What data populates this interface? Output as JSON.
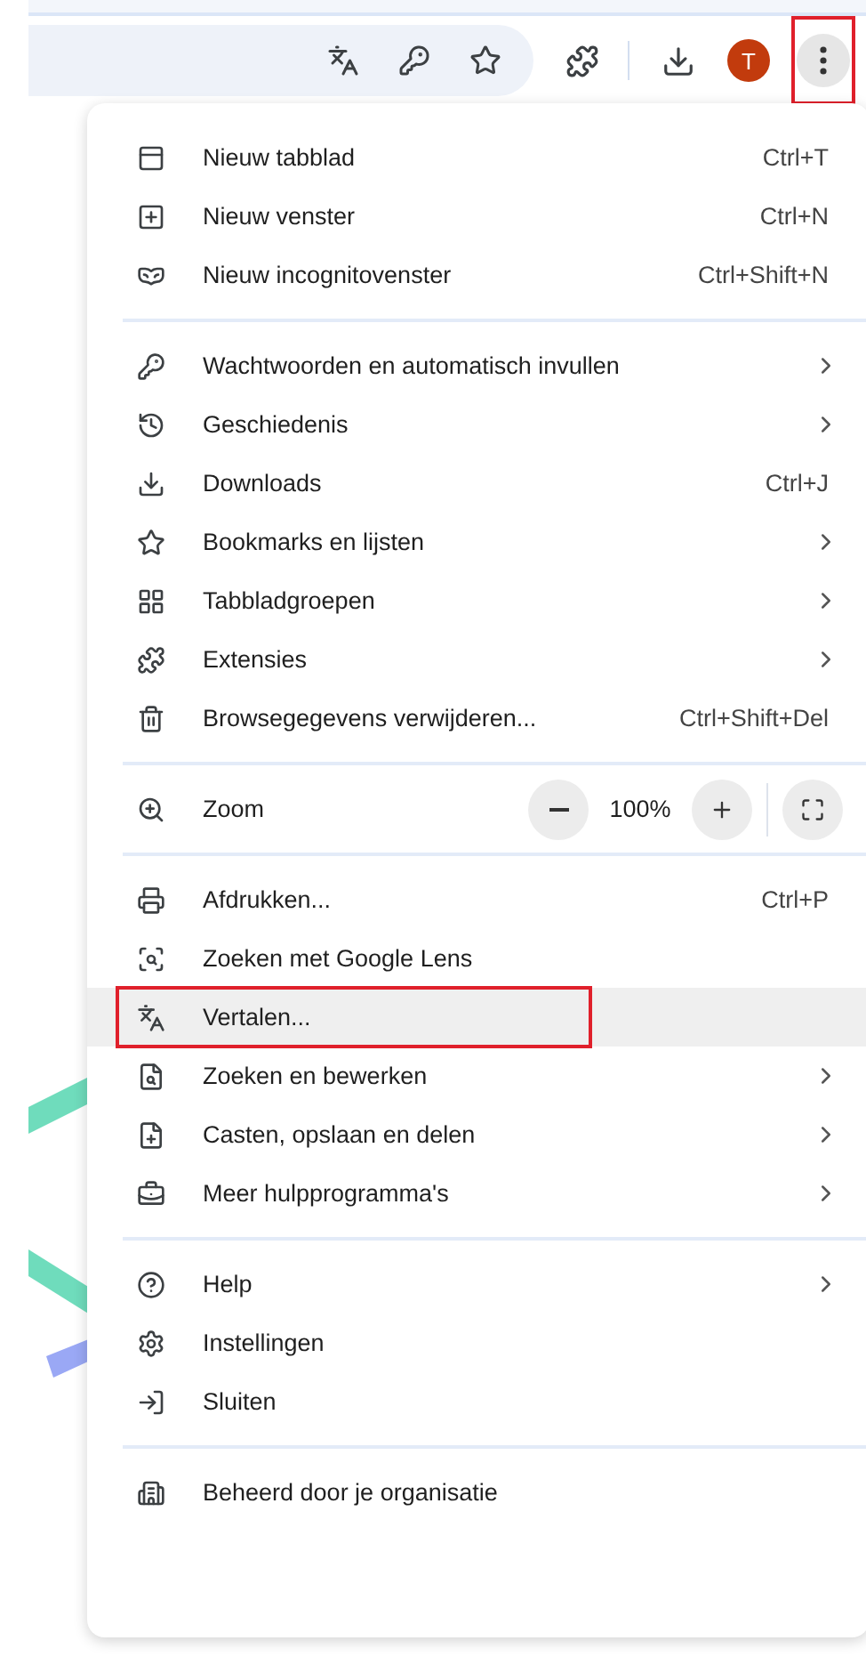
{
  "toolbar": {
    "avatar": "T",
    "menu_button": {
      "annotated": true
    }
  },
  "menu": {
    "sections": [
      {
        "kind": "items",
        "items": [
          {
            "label": "Nieuw tabblad",
            "shortcut": "Ctrl+T",
            "submenu": false,
            "highlighted": false,
            "annotated": false
          },
          {
            "label": "Nieuw venster",
            "shortcut": "Ctrl+N",
            "submenu": false,
            "highlighted": false,
            "annotated": false
          },
          {
            "label": "Nieuw incognitovenster",
            "shortcut": "Ctrl+Shift+N",
            "submenu": false,
            "highlighted": false,
            "annotated": false
          }
        ]
      },
      {
        "kind": "items",
        "items": [
          {
            "label": "Wachtwoorden en automatisch invullen",
            "submenu": true,
            "highlighted": false,
            "annotated": false
          },
          {
            "label": "Geschiedenis",
            "submenu": true,
            "highlighted": false,
            "annotated": false
          },
          {
            "label": "Downloads",
            "shortcut": "Ctrl+J",
            "submenu": false,
            "highlighted": false,
            "annotated": false
          },
          {
            "label": "Bookmarks en lijsten",
            "submenu": true,
            "highlighted": false,
            "annotated": false
          },
          {
            "label": "Tabbladgroepen",
            "submenu": true,
            "highlighted": false,
            "annotated": false
          },
          {
            "label": "Extensies",
            "submenu": true,
            "highlighted": false,
            "annotated": false
          },
          {
            "label": "Browsegegevens verwijderen...",
            "shortcut": "Ctrl+Shift+Del",
            "submenu": false,
            "highlighted": false,
            "annotated": false
          }
        ]
      },
      {
        "kind": "zoom",
        "label": "Zoom",
        "value": "100%"
      },
      {
        "kind": "items",
        "items": [
          {
            "label": "Afdrukken...",
            "shortcut": "Ctrl+P",
            "submenu": false,
            "highlighted": false,
            "annotated": false
          },
          {
            "label": "Zoeken met Google Lens",
            "submenu": false,
            "highlighted": false,
            "annotated": false
          },
          {
            "label": "Vertalen...",
            "submenu": false,
            "highlighted": true,
            "annotated": true
          },
          {
            "label": "Zoeken en bewerken",
            "submenu": true,
            "highlighted": false,
            "annotated": false
          },
          {
            "label": "Casten, opslaan en delen",
            "submenu": true,
            "highlighted": false,
            "annotated": false
          },
          {
            "label": "Meer hulpprogramma's",
            "submenu": true,
            "highlighted": false,
            "annotated": false
          }
        ]
      },
      {
        "kind": "items",
        "items": [
          {
            "label": "Help",
            "submenu": true,
            "highlighted": false,
            "annotated": false
          },
          {
            "label": "Instellingen",
            "submenu": false,
            "highlighted": false,
            "annotated": false
          },
          {
            "label": "Sluiten",
            "submenu": false,
            "highlighted": false,
            "annotated": false
          }
        ]
      },
      {
        "kind": "items",
        "items": [
          {
            "label": "Beheerd door je organisatie",
            "submenu": false,
            "highlighted": false,
            "annotated": false
          }
        ]
      }
    ]
  }
}
